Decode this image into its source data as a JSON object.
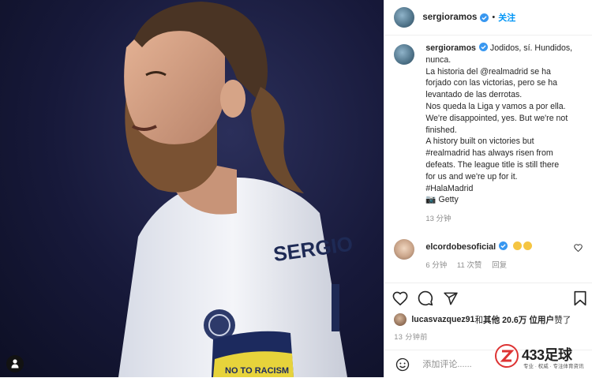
{
  "post": {
    "username": "sergioramos",
    "follow_label": "关注",
    "dot": "•"
  },
  "caption": {
    "username": "sergioramos",
    "lines": [
      "Jodidos, sí. Hundidos,",
      "nunca.",
      "La historia del @realmadrid se ha",
      "forjado con las victorias, pero se ha",
      "levantado de las derrotas.",
      "Nos queda la Liga y vamos a por ella.",
      "We're disappointed, yes. But we're not",
      "finished.",
      "A history built on victories but",
      "#realmadrid has always risen from",
      "defeats. The league title is still there",
      "for us and we're up for it.",
      "#HalaMadrid",
      "📷 Getty"
    ],
    "time": "13 分钟"
  },
  "comment": {
    "username": "elcordobesoficial",
    "time": "6 分钟",
    "likes": "11 次赞",
    "reply": "回复"
  },
  "likes": {
    "user": "lucasvazquez91",
    "connector": " 和 ",
    "others": "其他 20.6万 位用户",
    "suffix": " 赞了"
  },
  "post_time": "13 分钟前",
  "add_comment": {
    "placeholder": "添加评论......"
  },
  "watermark": {
    "brand": "433足球",
    "tagline": "专业 · 权威 · 专注体育资讯"
  },
  "photo": {
    "jersey_name": "SERGIO",
    "armband_text": "NO TO RACISM"
  },
  "colors": {
    "accent": "#0095f6",
    "verified": "#3897f0",
    "muted": "#8e8e8e"
  }
}
